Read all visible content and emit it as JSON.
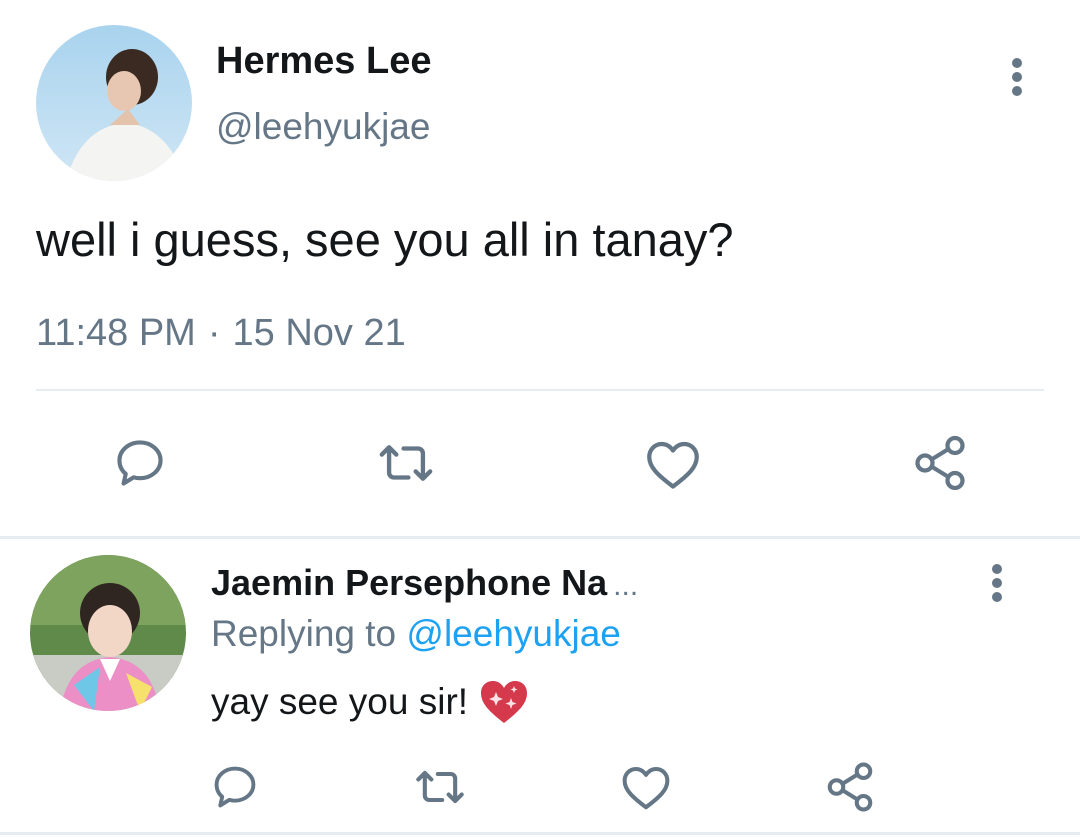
{
  "main_tweet": {
    "author_name": "Hermes Lee",
    "handle": "@leehyukjae",
    "text": "well i guess, see you all in tanay?",
    "time": "11:48 PM",
    "separator": "·",
    "date": "15 Nov 21",
    "more_icon": "more-vertical-icon",
    "actions": {
      "reply_icon": "reply-icon",
      "retweet_icon": "retweet-icon",
      "like_icon": "heart-icon",
      "share_icon": "share-icon"
    }
  },
  "reply_tweet": {
    "author_name": "Jaemin Persephone Na",
    "name_truncation": "...",
    "replying_to_label": "Replying to",
    "replying_to_handle": "@leehyukjae",
    "text": "yay see you sir!",
    "emoji": "sparkling-heart-emoji",
    "more_icon": "more-vertical-icon",
    "actions": {
      "reply_icon": "reply-icon",
      "retweet_icon": "retweet-icon",
      "like_icon": "heart-icon",
      "share_icon": "share-icon"
    }
  },
  "colors": {
    "text_primary": "#14171a",
    "text_secondary": "#657786",
    "link": "#1da1f2",
    "divider": "#e6ecf0",
    "icon": "#657786"
  }
}
